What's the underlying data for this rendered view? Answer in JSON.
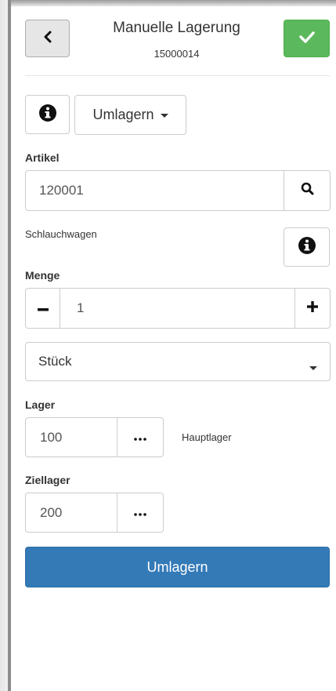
{
  "header": {
    "title": "Manuelle Lagerung",
    "subtitle": "15000014",
    "back_icon": "chevron-left-icon",
    "confirm_icon": "check-icon"
  },
  "toolbar": {
    "info_icon": "info-circle-icon",
    "mode_label": "Umlagern"
  },
  "artikel": {
    "label": "Artikel",
    "value": "120001",
    "search_icon": "search-icon",
    "description": "Schlauchwagen"
  },
  "menge": {
    "label": "Menge",
    "value": "1",
    "minus": "−",
    "plus": "+"
  },
  "unit": {
    "selected": "Stück"
  },
  "lager": {
    "label": "Lager",
    "value": "100",
    "more": "•••",
    "name": "Hauptlager"
  },
  "ziellager": {
    "label": "Ziellager",
    "value": "200",
    "more": "•••"
  },
  "submit": {
    "label": "Umlagern"
  },
  "colors": {
    "primary": "#337ab7",
    "success": "#5cb85c",
    "border": "#cccccc",
    "text": "#333333"
  }
}
